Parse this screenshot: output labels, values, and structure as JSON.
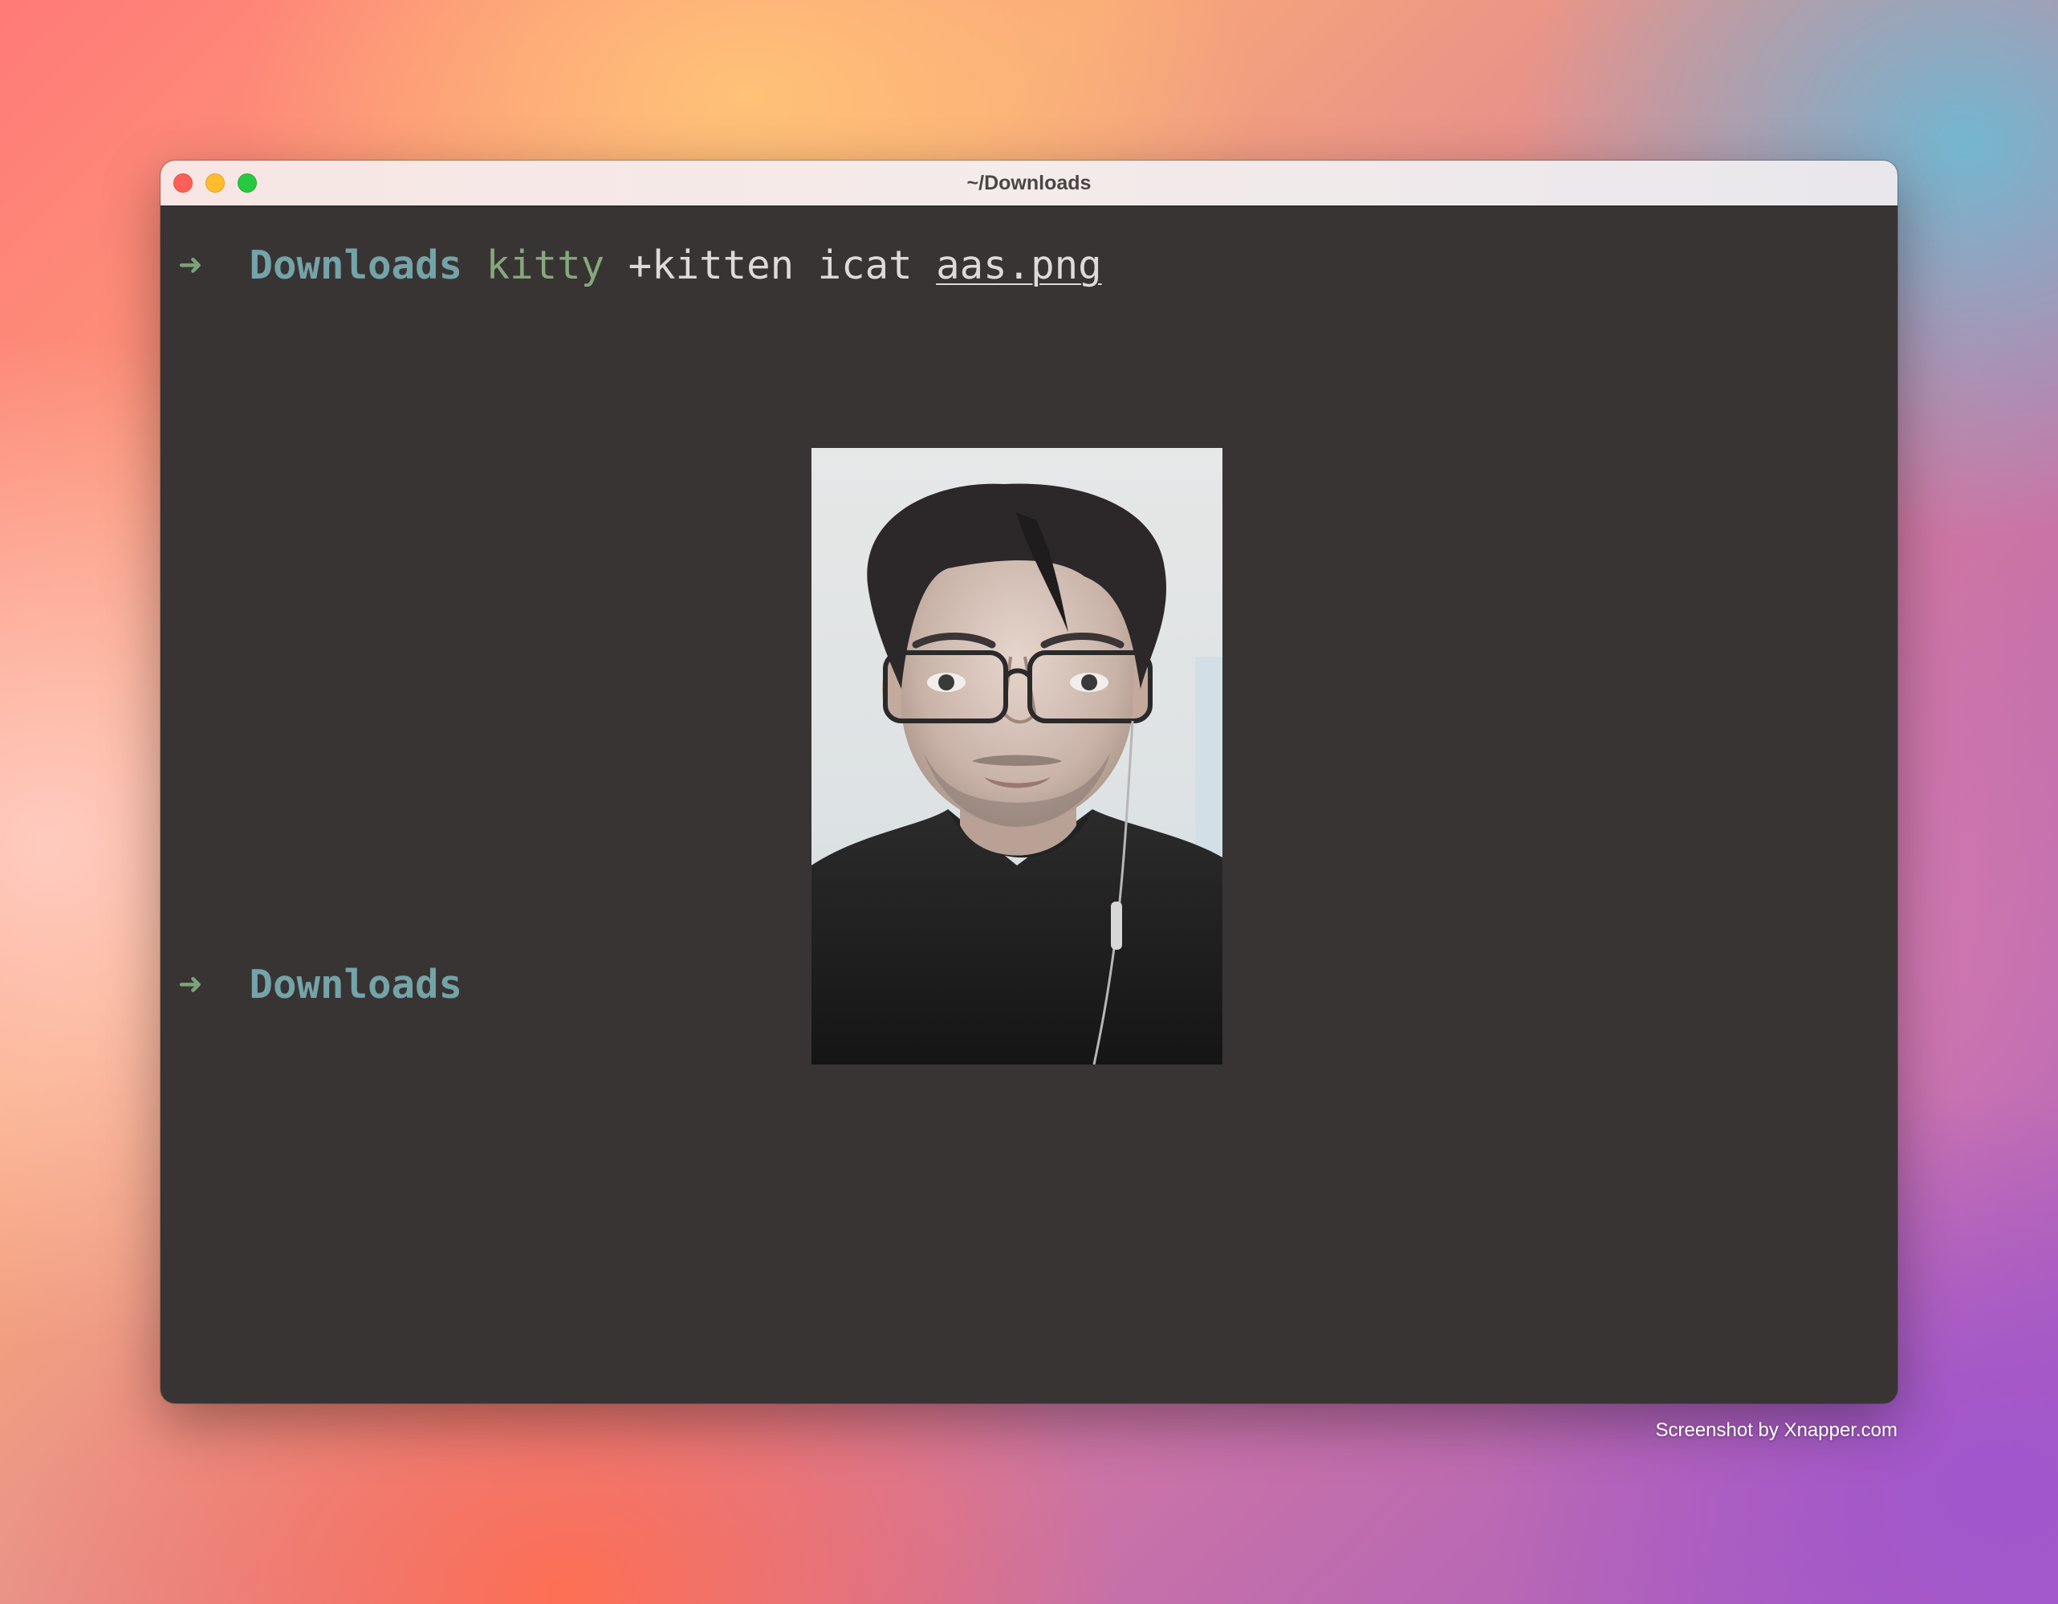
{
  "window": {
    "title": "~/Downloads"
  },
  "terminal": {
    "prompt_icon": "right-arrow-icon",
    "lines": [
      {
        "arrow": "➜",
        "directory": "Downloads",
        "command": "kitty",
        "args": "+kitten icat",
        "file": "aas.png"
      },
      {
        "arrow": "➜",
        "directory": "Downloads"
      }
    ],
    "image": {
      "description_icon": "portrait-image"
    }
  },
  "footer": {
    "credit": "Screenshot by Xnapper.com"
  },
  "colors": {
    "prompt_arrow": "#7ca278",
    "directory": "#74a3a8",
    "command": "#86a87b",
    "terminal_bg": "#383434",
    "text": "#dedad9"
  }
}
